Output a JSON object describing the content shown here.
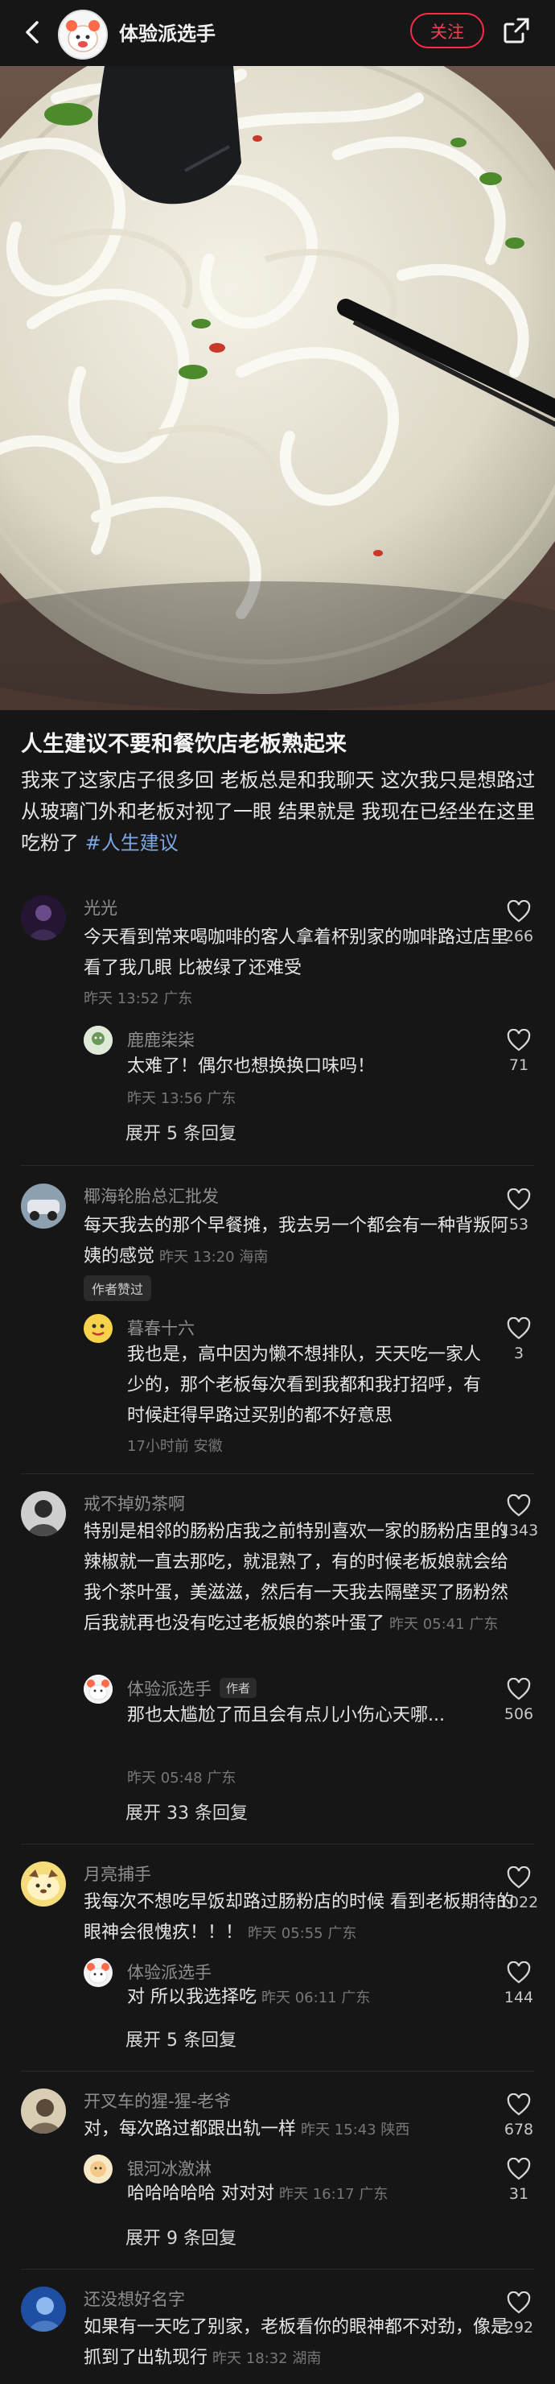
{
  "header": {
    "author_name": "体验派选手",
    "follow_label": "关注"
  },
  "post": {
    "title": "人生建议不要和餐饮店老板熟起来",
    "body": "我来了这家店子很多回 老板总是和我聊天 这次我只是想路过 从玻璃门外和老板对视了一眼 结果就是 我现在已经坐在这里吃粉了",
    "tag": "#人生建议"
  },
  "comments": [
    {
      "name": "光光",
      "text": "今天看到常来喝咖啡的客人拿着杯别家的咖啡路过店里看了我几眼 比被绿了还难受",
      "meta": "昨天 13:52 广东",
      "likes": "266",
      "reply": {
        "name": "鹿鹿柒柒",
        "text": "太难了！偶尔也想换换口味吗！",
        "meta": "昨天 13:56 广东",
        "likes": "71"
      },
      "expand": "展开 5 条回复"
    },
    {
      "name": "椰海轮胎总汇批发",
      "text": "每天我去的那个早餐摊，我去另一个都会有一种背叛阿姨的感觉",
      "meta": "昨天 13:20 海南",
      "likes": "53",
      "badge": "作者赞过",
      "reply": {
        "name": "暮春十六",
        "text": "我也是，高中因为懒不想排队，天天吃一家人少的，那个老板每次看到我都和我打招呼，有时候赶得早路过买别的都不好意思",
        "meta": "17小时前 安徽",
        "likes": "3"
      }
    },
    {
      "name": "戒不掉奶茶啊",
      "text": "特别是相邻的肠粉店我之前特别喜欢一家的肠粉店里的辣椒就一直去那吃，就混熟了，有的时候老板娘就会给我个茶叶蛋，美滋滋，然后有一天我去隔壁买了肠粉然后我就再也没有吃过老板娘的茶叶蛋了",
      "meta": "昨天 05:41 广东",
      "likes": "1343",
      "reply": {
        "name": "体验派选手",
        "author_badge": "作者",
        "text": "那也太尴尬了而且会有点儿小伤心天哪...",
        "meta": "昨天 05:48 广东",
        "likes": "506"
      },
      "expand": "展开 33 条回复"
    },
    {
      "name": "月亮捕手",
      "text": "我每次不想吃早饭却路过肠粉店的时候 看到老板期待的眼神会很愧疚！！！",
      "meta": "昨天 05:55 广东",
      "likes": "1022",
      "reply": {
        "name": "体验派选手",
        "text": "对 所以我选择吃",
        "meta": "昨天 06:11 广东",
        "likes": "144"
      },
      "expand": "展开 5 条回复"
    },
    {
      "name": "开叉车的猩-猩-老爷",
      "text": "对，每次路过都跟出轨一样",
      "meta": "昨天 15:43 陕西",
      "likes": "678",
      "reply": {
        "name": "银河冰激淋",
        "text": "哈哈哈哈哈 对对对",
        "meta": "昨天 16:17 广东",
        "likes": "31"
      },
      "expand": "展开 9 条回复"
    },
    {
      "name": "还没想好名字",
      "text": "如果有一天吃了别家，老板看你的眼神都不对劲，像是抓到了出轨现行",
      "meta": "昨天 18:32 湖南",
      "likes": "292"
    }
  ],
  "icons": {
    "back": "chevron-left-icon",
    "share": "share-icon",
    "heart": "heart-outline-icon",
    "emoji": "crying-face-emoji"
  },
  "colors": {
    "background": "#161616",
    "accent": "#ff2a48",
    "tag": "#7ea6e0"
  }
}
